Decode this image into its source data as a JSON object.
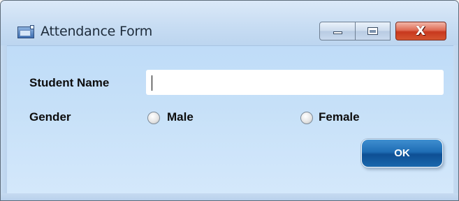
{
  "window": {
    "title": "Attendance Form",
    "app_icon": "window-app-icon",
    "controls": {
      "minimize_icon": "minimize-icon",
      "maximize_icon": "maximize-icon",
      "close_glyph": "X"
    }
  },
  "form": {
    "student_name_label": "Student Name",
    "student_name_value": "",
    "gender_label": "Gender",
    "gender_options": [
      {
        "label": "Male",
        "selected": false
      },
      {
        "label": "Female",
        "selected": false
      }
    ],
    "ok_label": "OK"
  },
  "colors": {
    "client_background": "#c6e0f8",
    "ok_button": "#1f6db5",
    "close_button": "#c8381e"
  }
}
